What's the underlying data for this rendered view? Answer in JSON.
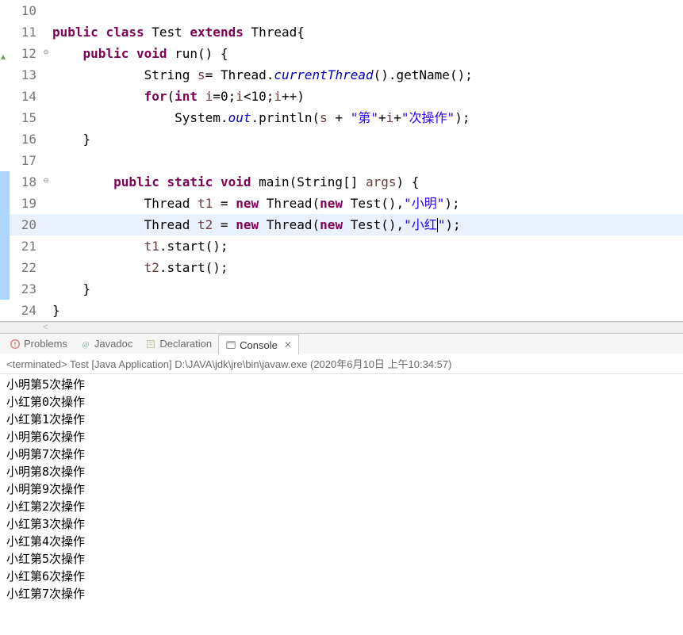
{
  "lines": [
    {
      "num": "10",
      "ann": "",
      "fold": "",
      "bluebar": false,
      "hl": false,
      "tokens": []
    },
    {
      "num": "11",
      "ann": "",
      "fold": "",
      "bluebar": false,
      "hl": false,
      "tokens": [
        {
          "c": "kw",
          "t": "public"
        },
        {
          "c": "plain",
          "t": " "
        },
        {
          "c": "kw",
          "t": "class"
        },
        {
          "c": "plain",
          "t": " Test "
        },
        {
          "c": "kw",
          "t": "extends"
        },
        {
          "c": "plain",
          "t": " Thread{"
        }
      ]
    },
    {
      "num": "12",
      "ann": "green",
      "fold": "⊖",
      "bluebar": false,
      "hl": false,
      "tokens": [
        {
          "c": "plain",
          "t": "    "
        },
        {
          "c": "kw",
          "t": "public"
        },
        {
          "c": "plain",
          "t": " "
        },
        {
          "c": "kw",
          "t": "void"
        },
        {
          "c": "plain",
          "t": " run() {"
        }
      ]
    },
    {
      "num": "13",
      "ann": "",
      "fold": "",
      "bluebar": false,
      "hl": false,
      "tokens": [
        {
          "c": "plain",
          "t": "            String "
        },
        {
          "c": "var",
          "t": "s"
        },
        {
          "c": "plain",
          "t": "= Thread."
        },
        {
          "c": "it",
          "t": "currentThread"
        },
        {
          "c": "plain",
          "t": "().getName();"
        }
      ]
    },
    {
      "num": "14",
      "ann": "",
      "fold": "",
      "bluebar": false,
      "hl": false,
      "tokens": [
        {
          "c": "plain",
          "t": "            "
        },
        {
          "c": "kw",
          "t": "for"
        },
        {
          "c": "plain",
          "t": "("
        },
        {
          "c": "kw",
          "t": "int"
        },
        {
          "c": "plain",
          "t": " "
        },
        {
          "c": "var",
          "t": "i"
        },
        {
          "c": "plain",
          "t": "=0;"
        },
        {
          "c": "var",
          "t": "i"
        },
        {
          "c": "plain",
          "t": "<10;"
        },
        {
          "c": "var",
          "t": "i"
        },
        {
          "c": "plain",
          "t": "++)"
        }
      ]
    },
    {
      "num": "15",
      "ann": "",
      "fold": "",
      "bluebar": false,
      "hl": false,
      "tokens": [
        {
          "c": "plain",
          "t": "                System."
        },
        {
          "c": "it",
          "t": "out"
        },
        {
          "c": "plain",
          "t": ".println("
        },
        {
          "c": "var",
          "t": "s"
        },
        {
          "c": "plain",
          "t": " + "
        },
        {
          "c": "str",
          "t": "\"第\""
        },
        {
          "c": "plain",
          "t": "+"
        },
        {
          "c": "var",
          "t": "i"
        },
        {
          "c": "plain",
          "t": "+"
        },
        {
          "c": "str",
          "t": "\"次操作\""
        },
        {
          "c": "plain",
          "t": ");"
        }
      ]
    },
    {
      "num": "16",
      "ann": "",
      "fold": "",
      "bluebar": false,
      "hl": false,
      "tokens": [
        {
          "c": "plain",
          "t": "    }"
        }
      ]
    },
    {
      "num": "17",
      "ann": "",
      "fold": "",
      "bluebar": false,
      "hl": false,
      "tokens": []
    },
    {
      "num": "18",
      "ann": "",
      "fold": "⊖",
      "bluebar": true,
      "hl": false,
      "tokens": [
        {
          "c": "plain",
          "t": "        "
        },
        {
          "c": "kw",
          "t": "public"
        },
        {
          "c": "plain",
          "t": " "
        },
        {
          "c": "kw",
          "t": "static"
        },
        {
          "c": "plain",
          "t": " "
        },
        {
          "c": "kw",
          "t": "void"
        },
        {
          "c": "plain",
          "t": " main(String[] "
        },
        {
          "c": "var",
          "t": "args"
        },
        {
          "c": "plain",
          "t": ") {"
        }
      ]
    },
    {
      "num": "19",
      "ann": "",
      "fold": "",
      "bluebar": true,
      "hl": false,
      "tokens": [
        {
          "c": "plain",
          "t": "            Thread "
        },
        {
          "c": "var",
          "t": "t1"
        },
        {
          "c": "plain",
          "t": " = "
        },
        {
          "c": "kw",
          "t": "new"
        },
        {
          "c": "plain",
          "t": " Thread("
        },
        {
          "c": "kw",
          "t": "new"
        },
        {
          "c": "plain",
          "t": " Test(),"
        },
        {
          "c": "str",
          "t": "\"小明\""
        },
        {
          "c": "plain",
          "t": ");"
        }
      ]
    },
    {
      "num": "20",
      "ann": "",
      "fold": "",
      "bluebar": true,
      "hl": true,
      "tokens": [
        {
          "c": "plain",
          "t": "            Thread "
        },
        {
          "c": "var",
          "t": "t2"
        },
        {
          "c": "plain",
          "t": " = "
        },
        {
          "c": "kw",
          "t": "new"
        },
        {
          "c": "plain",
          "t": " Thread("
        },
        {
          "c": "kw",
          "t": "new"
        },
        {
          "c": "plain",
          "t": " Test(),"
        },
        {
          "c": "str",
          "t": "\"小红"
        },
        {
          "c": "caret",
          "t": ""
        },
        {
          "c": "str",
          "t": "\""
        },
        {
          "c": "plain",
          "t": ");"
        }
      ]
    },
    {
      "num": "21",
      "ann": "",
      "fold": "",
      "bluebar": true,
      "hl": false,
      "tokens": [
        {
          "c": "plain",
          "t": "            "
        },
        {
          "c": "var",
          "t": "t1"
        },
        {
          "c": "plain",
          "t": ".start();"
        }
      ]
    },
    {
      "num": "22",
      "ann": "",
      "fold": "",
      "bluebar": true,
      "hl": false,
      "tokens": [
        {
          "c": "plain",
          "t": "            "
        },
        {
          "c": "var",
          "t": "t2"
        },
        {
          "c": "plain",
          "t": ".start();"
        }
      ]
    },
    {
      "num": "23",
      "ann": "",
      "fold": "",
      "bluebar": true,
      "hl": false,
      "tokens": [
        {
          "c": "plain",
          "t": "    }"
        }
      ]
    },
    {
      "num": "24",
      "ann": "",
      "fold": "",
      "bluebar": false,
      "hl": false,
      "tokens": [
        {
          "c": "plain",
          "t": "}"
        }
      ]
    }
  ],
  "tabs": {
    "problems": "Problems",
    "javadoc": "Javadoc",
    "declaration": "Declaration",
    "console": "Console"
  },
  "terminated": "<terminated> Test [Java Application] D:\\JAVA\\jdk\\jre\\bin\\javaw.exe (2020年6月10日 上午10:34:57)",
  "console": [
    "小明第5次操作",
    "小红第0次操作",
    "小红第1次操作",
    "小明第6次操作",
    "小明第7次操作",
    "小明第8次操作",
    "小明第9次操作",
    "小红第2次操作",
    "小红第3次操作",
    "小红第4次操作",
    "小红第5次操作",
    "小红第6次操作",
    "小红第7次操作"
  ],
  "scroll_hint": "<"
}
